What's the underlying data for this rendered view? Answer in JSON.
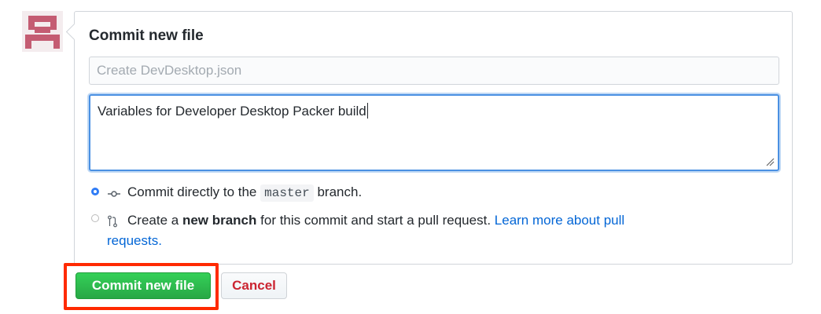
{
  "avatar": {
    "icon": "identicon",
    "color": "#c45c72"
  },
  "commit_form": {
    "title": "Commit new file",
    "summary_placeholder": "Create DevDesktop.json",
    "summary_value": "",
    "description_value": "Variables for Developer Desktop Packer build",
    "options": [
      {
        "selected": true,
        "icon": "git-commit-icon",
        "text_before": "Commit directly to the",
        "branch": "master",
        "text_after": "branch."
      },
      {
        "selected": false,
        "icon": "git-pull-request-icon",
        "text_before": "Create a",
        "bold": "new branch",
        "text_after": "for this commit and start a pull request.",
        "link_line1": "Learn more about pull",
        "link_line2": "requests."
      }
    ]
  },
  "buttons": {
    "commit_label": "Commit new file",
    "cancel_label": "Cancel"
  },
  "colors": {
    "commit_green": "#28a745",
    "cancel_red": "#cb2431",
    "link_blue": "#0366d6",
    "focus_blue": "#4a90e2",
    "highlight_red": "#ff2a00"
  }
}
